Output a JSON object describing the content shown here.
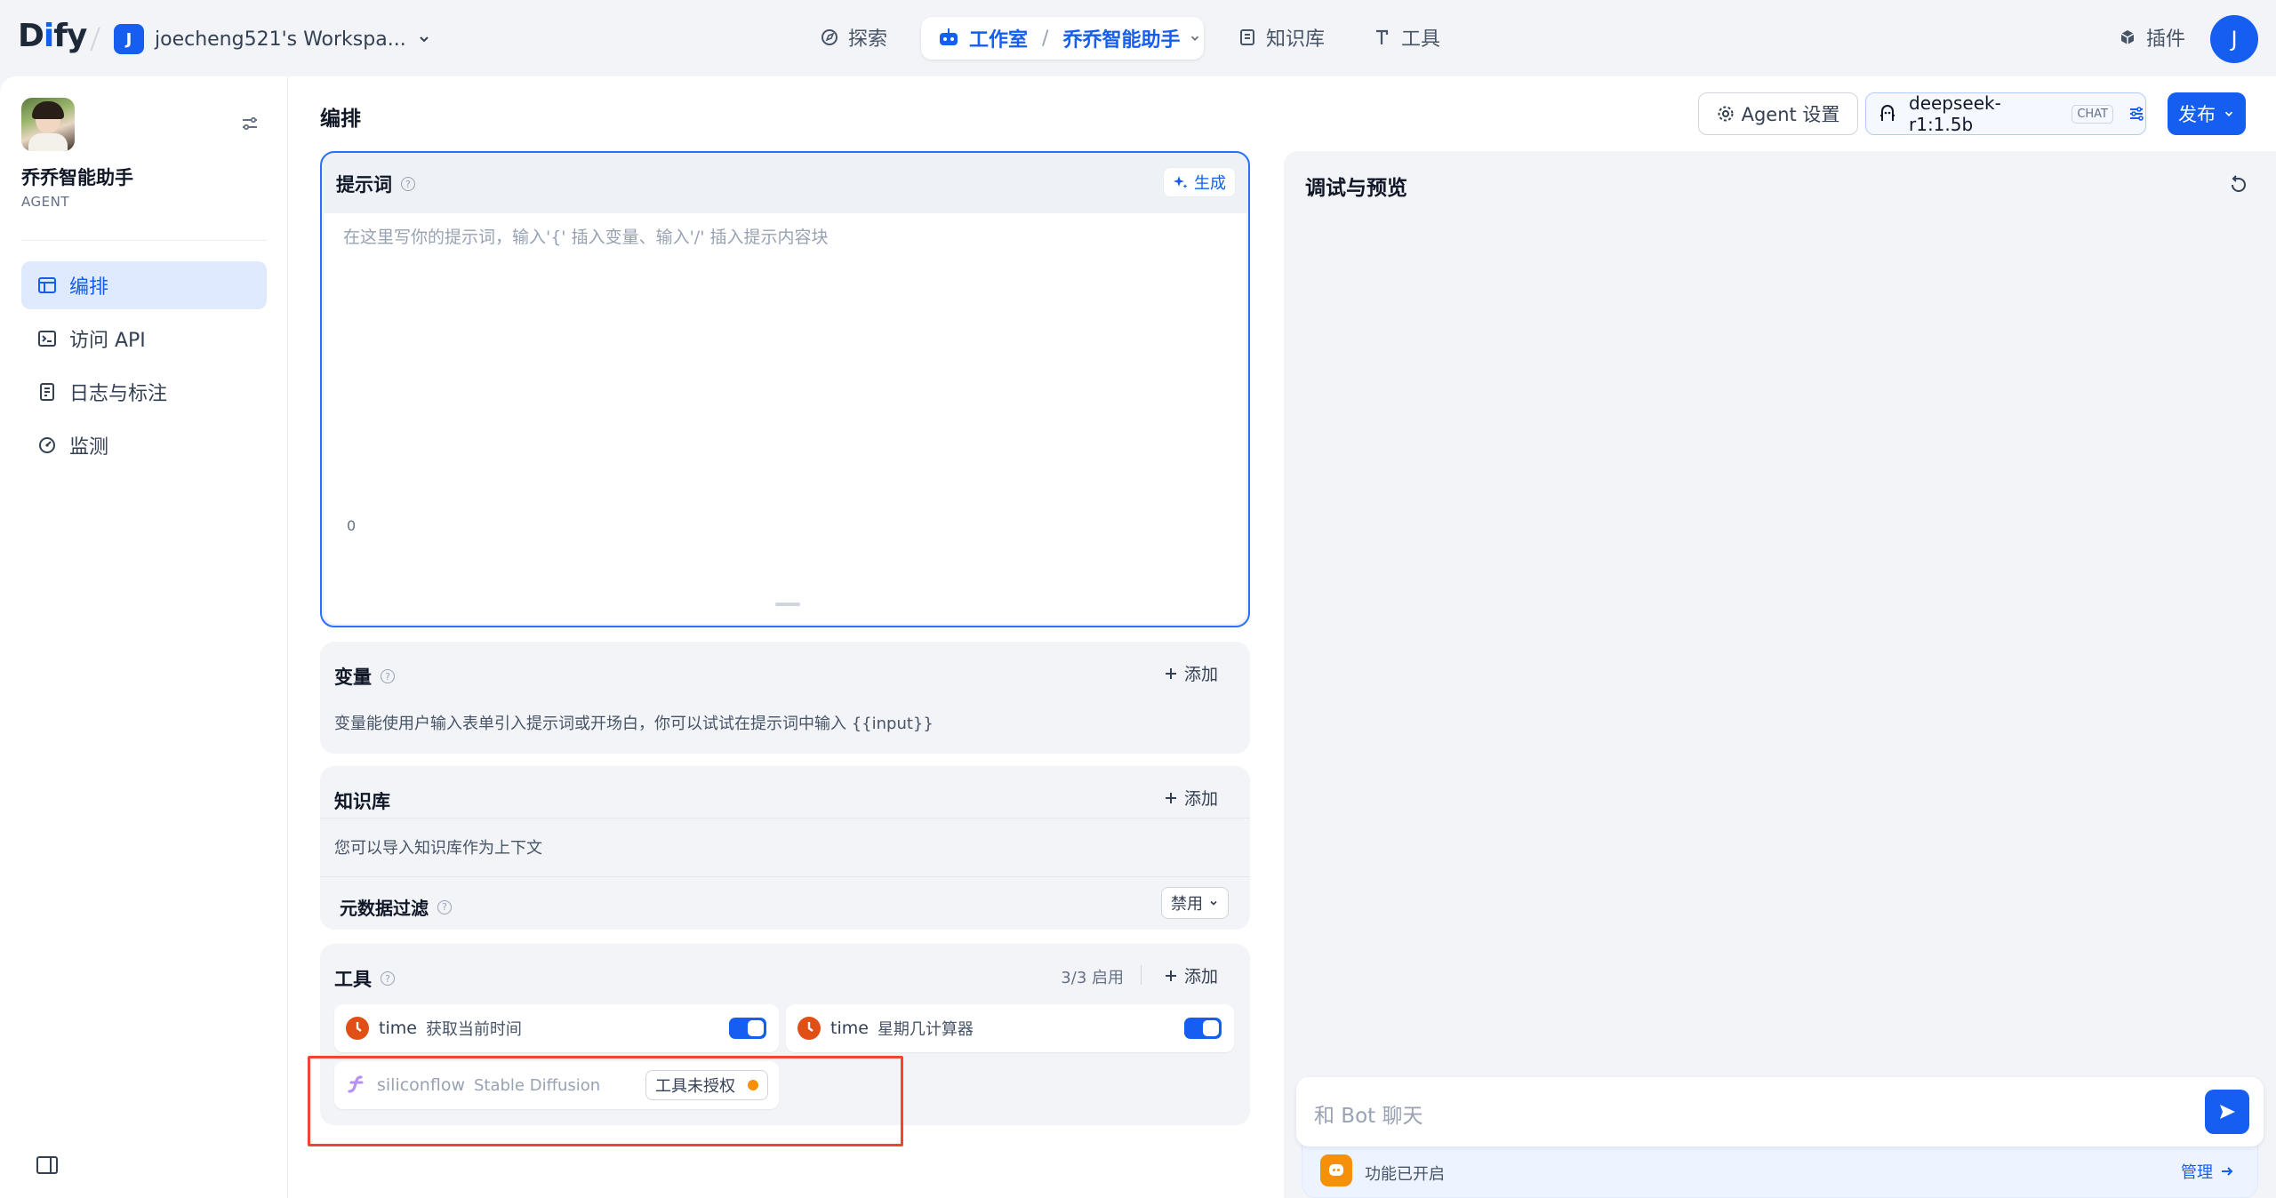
{
  "nav": {
    "logo_left": "D",
    "logo_i": "i",
    "logo_right": "fy",
    "workspace_initial": "J",
    "workspace_name": "joecheng521's Workspa...",
    "explore": "探索",
    "studio": "工作室",
    "app_name": "乔乔智能助手",
    "knowledge": "知识库",
    "tools": "工具",
    "plugins": "插件",
    "user_initial": "J"
  },
  "sidebar": {
    "app_title": "乔乔智能助手",
    "app_type": "AGENT",
    "items": [
      {
        "label": "编排"
      },
      {
        "label": "访问 API"
      },
      {
        "label": "日志与标注"
      },
      {
        "label": "监测"
      }
    ]
  },
  "header": {
    "title": "编排",
    "agent_settings": "Agent 设置",
    "model_name": "deepseek-r1:1.5b",
    "model_mode": "CHAT",
    "publish": "发布"
  },
  "prompt": {
    "title": "提示词",
    "generate": "生成",
    "placeholder": "在这里写你的提示词，输入'{' 插入变量、输入'/' 插入提示内容块",
    "char_count": "0"
  },
  "variables": {
    "title": "变量",
    "add": "添加",
    "desc": "变量能使用户输入表单引入提示词或开场白，你可以试试在提示词中输入 {{input}}"
  },
  "knowledge": {
    "title": "知识库",
    "add": "添加",
    "desc": "您可以导入知识库作为上下文",
    "metadata_title": "元数据过滤",
    "metadata_value": "禁用"
  },
  "tools": {
    "title": "工具",
    "count": "3/3 启用",
    "add": "添加",
    "items": [
      {
        "provider": "time",
        "name": "获取当前时间"
      },
      {
        "provider": "time",
        "name": "星期几计算器"
      },
      {
        "provider": "siliconflow",
        "name": "Stable Diffusion",
        "status": "工具未授权"
      }
    ]
  },
  "preview": {
    "title": "调试与预览",
    "chat_placeholder": "和 Bot 聊天",
    "features_enabled": "功能已开启",
    "manage": "管理"
  },
  "colors": {
    "primary": "#155eef",
    "time_icon": "#e04f16",
    "warning_dot": "#f79009",
    "highlight_box": "#f04438"
  }
}
